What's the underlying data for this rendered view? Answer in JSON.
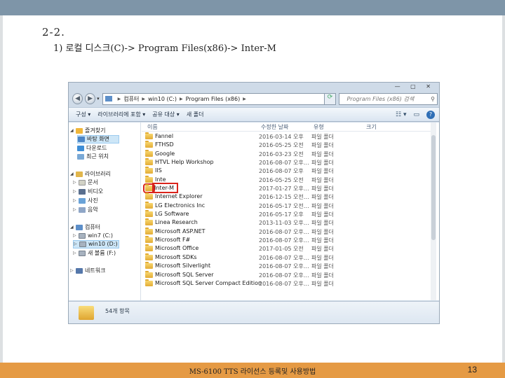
{
  "slide": {
    "title": "2-2.",
    "subtitle": "1) 로컬 디스크(C)-> Program Files(x86)-> Inter-M",
    "footer": "MS-6100 TTS 라이선스 등록및 사용방법",
    "page_number": "13"
  },
  "window": {
    "address": [
      "컴퓨터",
      "win10 (C:)",
      "Program Files (x86)"
    ],
    "search_placeholder": "Program Files (x86) 검색",
    "toolbar": [
      "구성 ▾",
      "라이브러리에 포함 ▾",
      "공유 대상 ▾",
      "새 폴더"
    ],
    "columns": {
      "name": "이름",
      "date": "수정한 날짜",
      "type": "유형",
      "size": "크기"
    },
    "nav": [
      {
        "label": "즐겨찾기",
        "icon": "star-icon"
      },
      {
        "label": "바탕 화면",
        "icon": "desktop-icon"
      },
      {
        "label": "다운로드",
        "icon": "download-icon"
      },
      {
        "label": "최근 위치",
        "icon": "recent-icon"
      },
      {
        "label": "라이브러리",
        "icon": "library-icon"
      },
      {
        "label": "문서",
        "icon": "document-icon"
      },
      {
        "label": "비디오",
        "icon": "video-icon"
      },
      {
        "label": "사진",
        "icon": "picture-icon"
      },
      {
        "label": "음악",
        "icon": "music-icon"
      },
      {
        "label": "컴퓨터",
        "icon": "computer-icon"
      },
      {
        "label": "win7 (C:)",
        "icon": "drive-icon"
      },
      {
        "label": "win10 (D:)",
        "icon": "drive-icon"
      },
      {
        "label": "새 볼륨 (F:)",
        "icon": "drive-icon"
      },
      {
        "label": "네트워크",
        "icon": "network-icon"
      }
    ],
    "files": [
      {
        "name": "Fannel",
        "date": "2016-03-14 오후",
        "type": "파일 폴더"
      },
      {
        "name": "FTHSD",
        "date": "2016-05-25 오전",
        "type": "파일 폴더"
      },
      {
        "name": "Google",
        "date": "2016-03-23 오전",
        "type": "파일 폴더"
      },
      {
        "name": "HTVL Help Workshop",
        "date": "2016-08-07 오후…",
        "type": "파일 폴더"
      },
      {
        "name": "IIS",
        "date": "2016-08-07 오후",
        "type": "파일 폴더"
      },
      {
        "name": "Inte",
        "date": "2016-05-25 오전",
        "type": "파일 폴더"
      },
      {
        "name": "Inter-M",
        "date": "2017-01-27 오후…",
        "type": "파일 폴더"
      },
      {
        "name": "Internet Explorer",
        "date": "2016-12-15 오전…",
        "type": "파일 폴더"
      },
      {
        "name": "LG Electronics Inc",
        "date": "2016-05-17 오전…",
        "type": "파일 폴더"
      },
      {
        "name": "LG Software",
        "date": "2016-05-17 오후",
        "type": "파일 폴더"
      },
      {
        "name": "Linea Research",
        "date": "2013-11-03 오후…",
        "type": "파일 폴더"
      },
      {
        "name": "Microsoft ASP.NET",
        "date": "2016-08-07 오후…",
        "type": "파일 폴더"
      },
      {
        "name": "Microsoft F#",
        "date": "2016-08-07 오후…",
        "type": "파일 폴더"
      },
      {
        "name": "Microsoft Office",
        "date": "2017-01-05 오전",
        "type": "파일 폴더"
      },
      {
        "name": "Microsoft SDKs",
        "date": "2016-08-07 오후…",
        "type": "파일 폴더"
      },
      {
        "name": "Microsoft Silverlight",
        "date": "2016-08-07 오후…",
        "type": "파일 폴더"
      },
      {
        "name": "Microsoft SQL Server",
        "date": "2016-08-07 오후…",
        "type": "파일 폴더"
      },
      {
        "name": "Microsoft SQL Server Compact Edition",
        "date": "2016-08-07 오후…",
        "type": "파일 폴더"
      }
    ],
    "highlighted_item": "Inter-M",
    "status": "54개 항목"
  }
}
